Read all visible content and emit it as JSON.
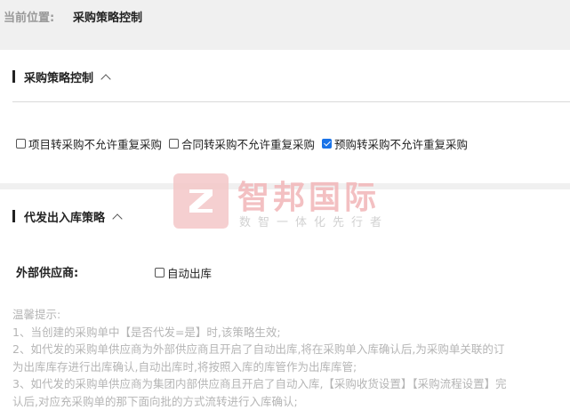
{
  "breadcrumb": {
    "label": "当前位置:",
    "value": "采购策略控制"
  },
  "section1": {
    "title": "采购策略控制",
    "options": [
      {
        "label": "项目转采购不允许重复采购",
        "checked": false
      },
      {
        "label": "合同转采购不允许重复采购",
        "checked": false
      },
      {
        "label": "预购转采购不允许重复采购",
        "checked": true
      }
    ]
  },
  "section2": {
    "title": "代发出入库策略",
    "vendor_label": "外部供应商:",
    "auto_out_label": "自动出库"
  },
  "tips": [
    "温馨提示:",
    "1、当创建的采购单中【是否代发=是】时,该策略生效;",
    "2、如代发的采购单供应商为外部供应商且开启了自动出库,将在采购单入库确认后,为采购单关联的订",
    "为出库库存进行出库确认,自动出库时,将按照入库的库管作为出库库管;",
    "3、如代发的采购单供应商为集团内部供应商且开启了自动入库,【采购收货设置】【采购流程设置】完",
    "认后,对应充采购单的那下面向批的方式流转进行入库确认;"
  ],
  "watermark": {
    "main": "智邦国际",
    "sub": "数智一体化先行者"
  },
  "colors": {
    "accent": "#1a73e8",
    "watermark": "#f2b6b8"
  }
}
